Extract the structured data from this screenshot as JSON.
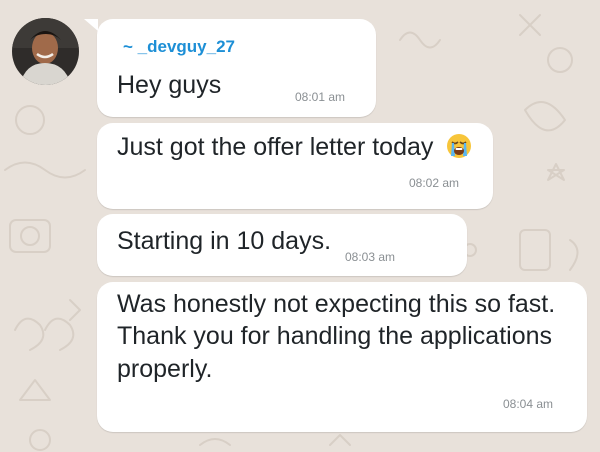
{
  "chat": {
    "sender": "~ _devguy_27",
    "messages": [
      {
        "text": "Hey guys",
        "time": "08:01 am"
      },
      {
        "text": "Just got the offer letter today",
        "emoji": "loudly-crying-face-icon",
        "time": "08:02 am"
      },
      {
        "text": "Starting in 10 days.",
        "time": "08:03 am"
      },
      {
        "lines": [
          "Was honestly not expecting this so fast.",
          "Thank you for handling the applications",
          "properly."
        ],
        "time": "08:04 am"
      }
    ]
  },
  "colors": {
    "background": "#e8e1da",
    "bubble": "#ffffff",
    "sender_name": "#1d8fd6",
    "timestamp": "#8a8f93"
  }
}
